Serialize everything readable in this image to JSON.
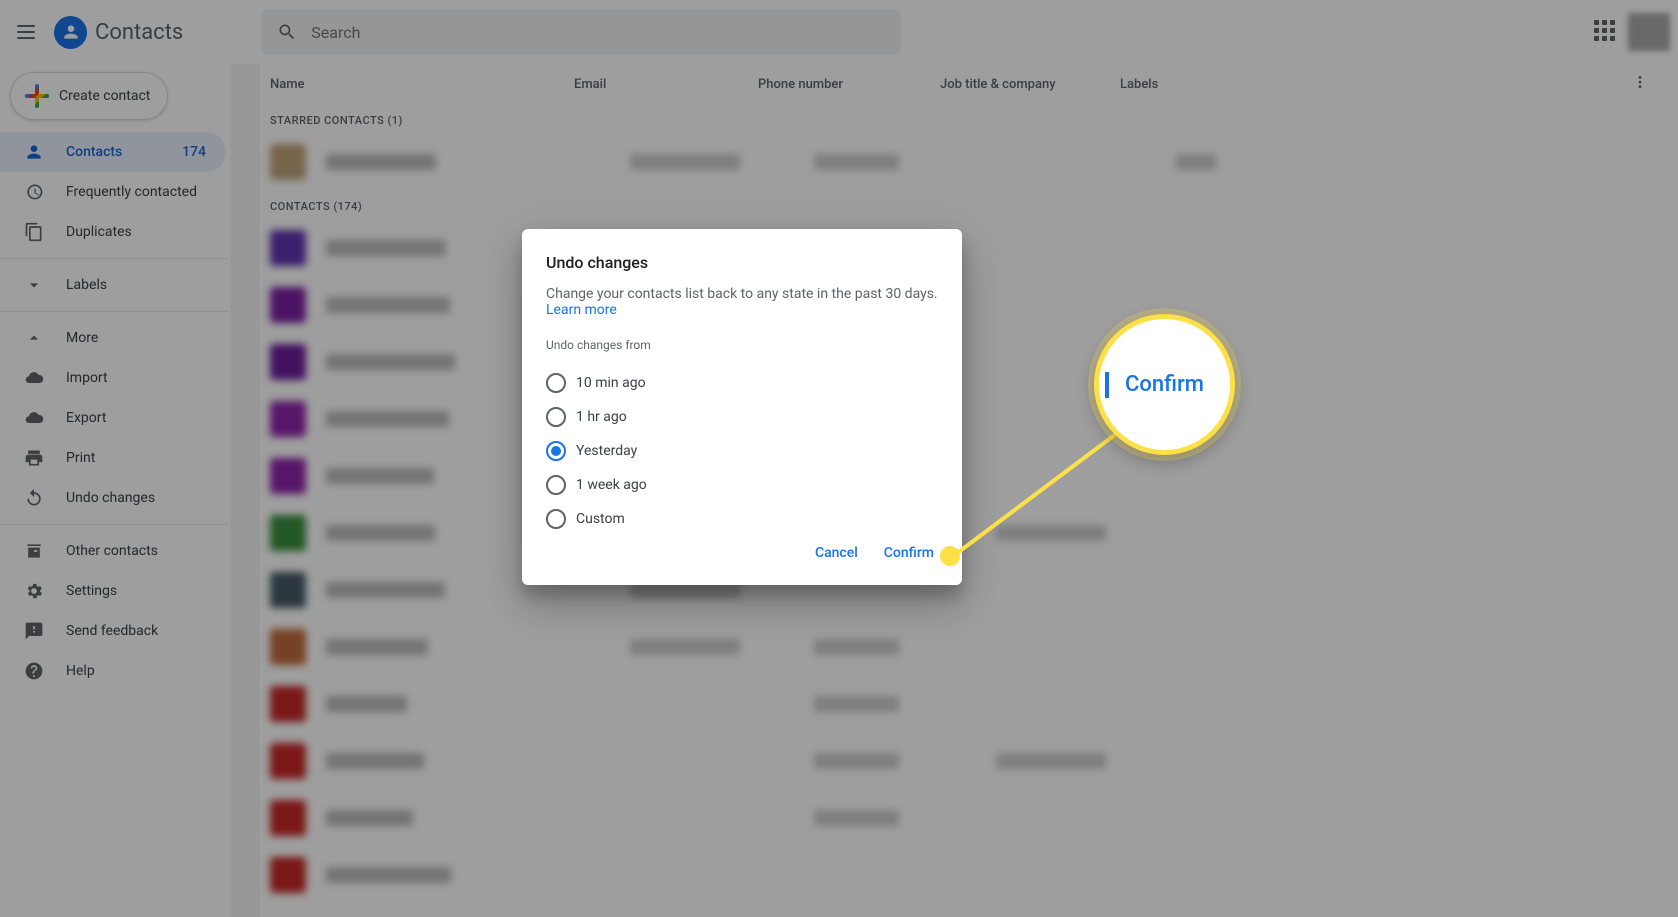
{
  "app": {
    "title": "Contacts"
  },
  "search": {
    "placeholder": "Search"
  },
  "create_button": "Create contact",
  "sidebar": {
    "contacts": {
      "label": "Contacts",
      "count": "174"
    },
    "frequently": "Frequently contacted",
    "duplicates": "Duplicates",
    "labels": "Labels",
    "more": "More",
    "import": "Import",
    "export": "Export",
    "print": "Print",
    "undo": "Undo changes",
    "other": "Other contacts",
    "settings": "Settings",
    "feedback": "Send feedback",
    "help": "Help"
  },
  "columns": {
    "name": "Name",
    "email": "Email",
    "phone": "Phone number",
    "job": "Job title & company",
    "labels": "Labels"
  },
  "sections": {
    "starred": "STARRED CONTACTS (1)",
    "contacts": "CONTACTS (174)"
  },
  "dialog": {
    "title": "Undo changes",
    "description": "Change your contacts list back to any state in the past 30 days. ",
    "learn_more": "Learn more",
    "from_label": "Undo changes from",
    "options": {
      "o1": "10 min ago",
      "o2": "1 hr ago",
      "o3": "Yesterday",
      "o4": "1 week ago",
      "o5": "Custom"
    },
    "cancel": "Cancel",
    "confirm": "Confirm"
  },
  "callout": {
    "text": "Confirm"
  },
  "row_colors": [
    "#bfa37a",
    "#5e35b1",
    "#7b1fa2",
    "#6a1b9a",
    "#8e24aa",
    "#8e24aa",
    "#388e3c",
    "#455a64",
    "#bf6a3a",
    "#c62828",
    "#c62828"
  ]
}
